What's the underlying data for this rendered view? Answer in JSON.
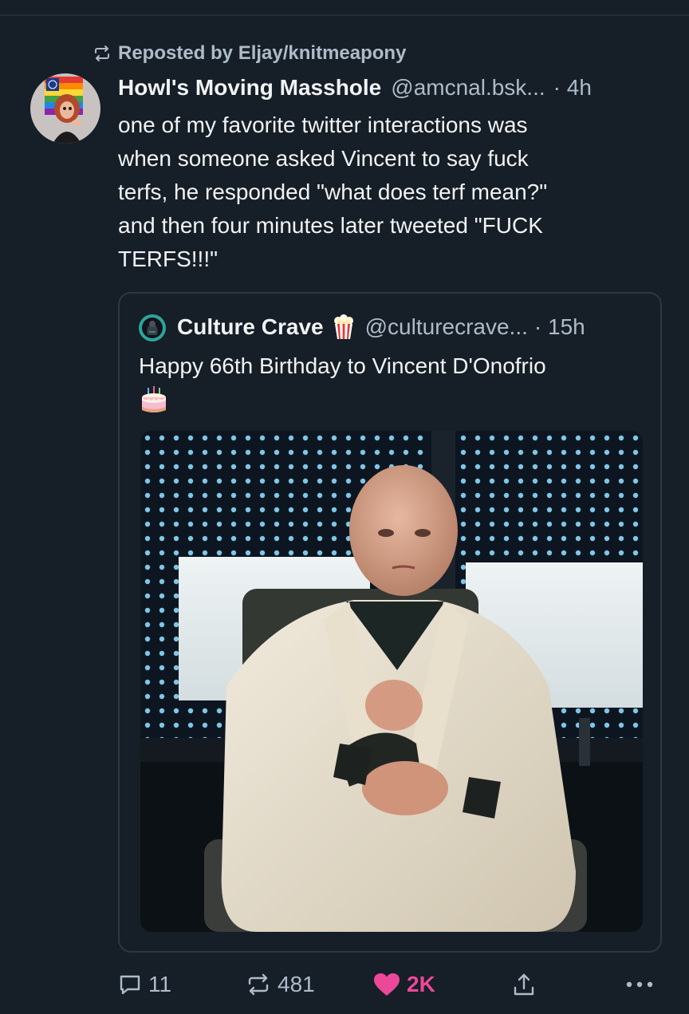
{
  "repost": {
    "label": "Reposted by Eljay/knitmeapony",
    "icon": "repost-icon"
  },
  "post": {
    "author_name": "Howl's Moving Masshole",
    "author_handle": "@amcnal.bsk...",
    "time": "· 4h",
    "text": "one of my favorite twitter interactions was\nwhen someone asked Vincent to say fuck\nterfs, he responded \"what does terf mean?\"\nand then four minutes later tweeted \"FUCK\nTERFS!!!\""
  },
  "quote": {
    "author_name": "Culture Crave",
    "badge_icon": "popcorn-icon",
    "author_handle": "@culturecrave...",
    "time": "· 15h",
    "text": "Happy 66th Birthday to Vincent D'Onofrio",
    "emoji": "birthday-cake-icon"
  },
  "actions": {
    "reply_count": "11",
    "repost_count": "481",
    "like_count": "2K"
  },
  "colors": {
    "background": "#161e27",
    "primary_text": "#f1f3f5",
    "secondary_text": "#aebbc9",
    "like_accent": "#ec4899",
    "card_border": "#2b3744"
  }
}
